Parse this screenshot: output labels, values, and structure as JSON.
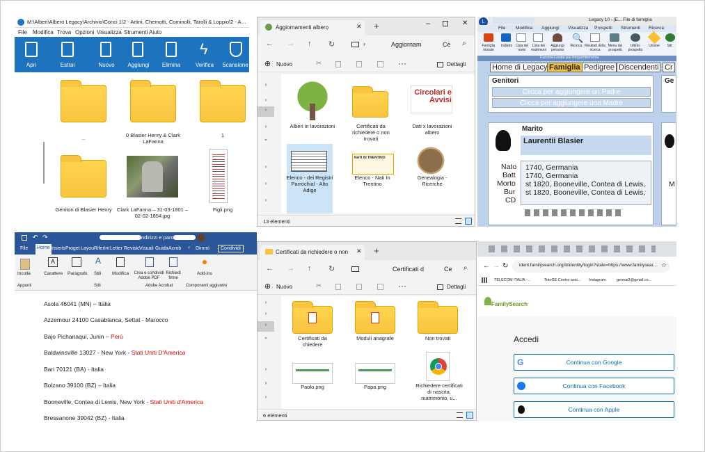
{
  "legacy_explorer": {
    "title": "M:\\Alberi\\Albero Legacy\\Archivio\\Conci 1\\2 - Artini, Chemotti, Cominolli, Tarolli & Loppio\\2 - Ar...",
    "menu": [
      "File",
      "Modifica",
      "Trova",
      "Opzioni",
      "Visualizza",
      "Strumenti",
      "Aiuto"
    ],
    "toolbar": [
      "Apri",
      "Estrai",
      "Nuovo",
      "Aggiungi",
      "Elimina",
      "Verifica",
      "Scansione"
    ],
    "items": [
      {
        "label": "..",
        "kind": "folder"
      },
      {
        "label": "0 Blasier Henry & Clark LaFanna",
        "kind": "folder"
      },
      {
        "label": "1",
        "kind": "folder"
      },
      {
        "label": "Genitori di  Blasier Henry",
        "kind": "folder"
      },
      {
        "label": "Clark LaFanna – 31-03-1801 – 02-02-1854.jpg",
        "kind": "photo"
      },
      {
        "label": "Figli.png",
        "kind": "doc"
      }
    ]
  },
  "explorer1": {
    "tab": "Aggiornamenti albero",
    "address": "Aggiornam",
    "new_label": "Nuovo",
    "details": "Dettagli",
    "status": "13 elementi",
    "items": [
      "Alberi in lavorazioni",
      "Certificati da richiedere o non trovati",
      "Dati x lavorazioni albero",
      "Elenco -  dei Registri Parrochial - Alto Adige",
      "Elenco - Nati In Trentino",
      "Genealogia - Ricerche"
    ],
    "circ_text": "Circolari e Avvisi",
    "nati_text": "NATI IN TRENTINO"
  },
  "legacy": {
    "title": "Legacy 10 - [E... File di famiglia",
    "menu": [
      "File",
      "Modifica",
      "Aggiungi",
      "Visualizza",
      "Prospetti",
      "Strumenti",
      "Ricerca"
    ],
    "tools": [
      "Famiglia iniziale",
      "Indietro",
      "Lista dei nomi",
      "Lista dei matrimoni",
      "Aggiungi persona",
      "Ricerca",
      "Risultati della ricerca",
      "Menu dei prospetti",
      "Ultimo prospetto",
      "Unione",
      "Siti"
    ],
    "frequent": "Funzioni usate più frequentemente",
    "tabs": [
      "Home di Legacy",
      "Famiglia",
      "Pedigree",
      "Discendenti",
      "Cr"
    ],
    "genitori": "Genitori",
    "add_father": "Clicca per aggiungere un Padre",
    "add_mother": "Clicca per aggiungere una Madre",
    "ge": "Ge",
    "marito": "Marito",
    "name": "Laurentii Blasier",
    "labels": [
      "Nato",
      "Batt",
      "Morto",
      "Bur",
      "CD"
    ],
    "values": [
      "1740, Germania",
      "1740, Germania",
      "st 1820, Booneville, Contea di Lewis,",
      "st 1820, Booneville, Contea di Lewis,",
      ""
    ],
    "m": "M"
  },
  "word": {
    "title": "ndirizzi e paro...",
    "tabs": [
      "File",
      "Home",
      "Inseris",
      "Proget",
      "Layou",
      "Riferim",
      "Letter",
      "Revisic",
      "Visuali",
      "Guida",
      "Acrob"
    ],
    "dimmi": "Dimmi",
    "share": "Condividi",
    "groups": [
      {
        "label": "Incolla",
        "group": "Appunti"
      },
      {
        "label": "Carattere",
        "group": ""
      },
      {
        "label": "Paragrafo",
        "group": ""
      },
      {
        "label": "Stili",
        "group": "Stili"
      },
      {
        "label": "Modifica",
        "group": ""
      },
      {
        "label": "Crea e condividi Adobe PDF",
        "group": "Adobe Acrobat"
      },
      {
        "label": "Richiedi firme",
        "group": ""
      },
      {
        "label": "Add-ins",
        "group": "Componenti aggiuntivi"
      }
    ],
    "lines": [
      {
        "text": "Asola 46041 (MN) – Italia",
        "red": ""
      },
      {
        "text": "Azzemour 24100 Casablanca, Settat - Marocco",
        "red": ""
      },
      {
        "text": "Bajo Pichanaqui, Junin – ",
        "red": "Perù"
      },
      {
        "text": "Baldwinsville 13027 - New York - ",
        "red": "Stati Uniti D'America"
      },
      {
        "text": "Bari 70121 (BA) - Italia",
        "red": ""
      },
      {
        "text": "Bolzano 39100 (BZ) – Italia",
        "red": ""
      },
      {
        "text": "Booneville, Contea di Lewis, New York - ",
        "red": "Stati Uniti d'America"
      },
      {
        "text": "Bressanone 39042 (BZ) - Italia",
        "red": ""
      }
    ]
  },
  "explorer2": {
    "tab": "Certificati da richiedere o non",
    "address": "Certificati d",
    "new_label": "Nuovo",
    "details": "Dettagli",
    "status": "6 elementi",
    "items": [
      "Certificati da chiedere",
      "Moduli anagrafe",
      "Non trovati",
      "Paolo.png",
      "Papa.png",
      "Richiedere certificati di nascita, matrimonio, u..."
    ]
  },
  "browser": {
    "url": "ident.familysearch.org/it/identity/login?state=https://www.familysearch...",
    "bookmarks": [
      "TELECOM ITALIA -...",
      "TotoGE Centro assi...",
      "Instagram",
      "gennai3@gmail.co..."
    ],
    "brand": "FamilySearch",
    "accedi": "Accedi",
    "buttons": [
      "Continua con Google",
      "Continua con Facebook",
      "Continua con Apple"
    ]
  }
}
